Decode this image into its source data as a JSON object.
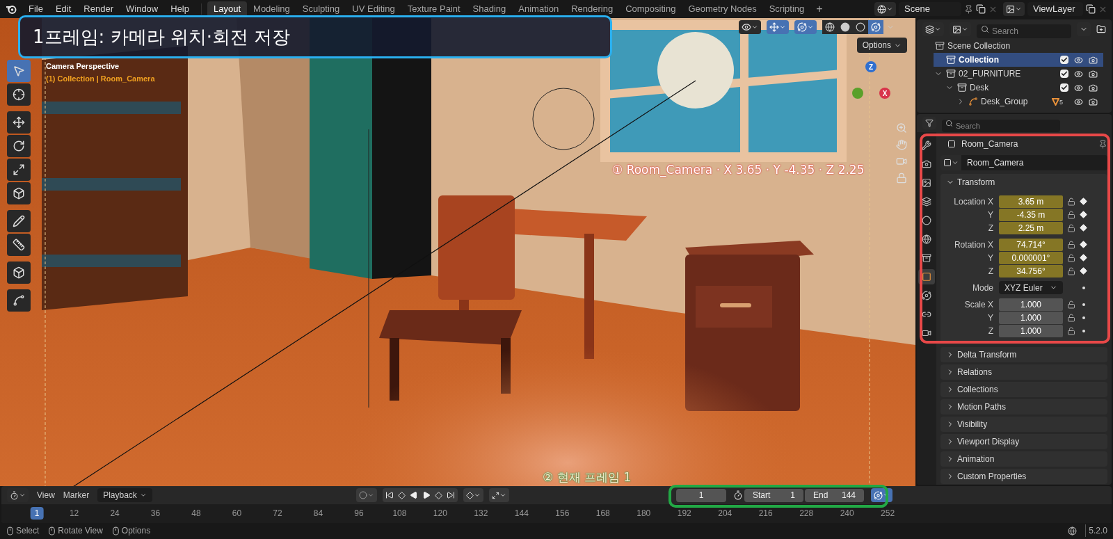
{
  "menus": [
    "File",
    "Edit",
    "Render",
    "Window",
    "Help"
  ],
  "workspaces": [
    {
      "label": "Layout",
      "selected": true
    },
    {
      "label": "Modeling",
      "selected": false
    },
    {
      "label": "Sculpting",
      "selected": false
    },
    {
      "label": "UV Editing",
      "selected": false
    },
    {
      "label": "Texture Paint",
      "selected": false
    },
    {
      "label": "Shading",
      "selected": false
    },
    {
      "label": "Animation",
      "selected": false
    },
    {
      "label": "Rendering",
      "selected": false
    },
    {
      "label": "Compositing",
      "selected": false
    },
    {
      "label": "Geometry Nodes",
      "selected": false
    },
    {
      "label": "Scripting",
      "selected": false
    }
  ],
  "add_workspace": "+",
  "scene": "Scene",
  "view_layer": "ViewLayer",
  "viewport": {
    "view_name": "Camera Perspective",
    "context": "(1) Collection | Room_Camera",
    "options": "Options",
    "shading_modes": [
      {
        "kind": "wireframe",
        "selected": false
      },
      {
        "kind": "solid",
        "selected": false
      },
      {
        "kind": "material",
        "selected": false
      },
      {
        "kind": "rendered",
        "selected": true
      }
    ],
    "gizmo_axes": [
      {
        "label": "Z",
        "color": "#2f6fd0"
      },
      {
        "label": "X",
        "color": "#d8344a"
      }
    ]
  },
  "callouts": {
    "title": "1프레임: 카메라 위치·회전 저장",
    "camera_label": "① Room_Camera · X 3.65 · Y -4.35 · Z 2.25",
    "frame_label": "② 현재 프레임 1"
  },
  "outliner": {
    "search_placeholder": "Search",
    "tree": [
      {
        "name": "Scene Collection",
        "kind": "scene",
        "selected": false,
        "children": [
          {
            "name": "Collection",
            "kind": "collection",
            "selected": true,
            "checked": true
          },
          {
            "name": "02_FURNITURE",
            "kind": "collection",
            "selected": false,
            "checked": true,
            "expanded": true,
            "children": [
              {
                "name": "Desk",
                "kind": "collection",
                "selected": false,
                "checked": true,
                "expanded": true,
                "children": [
                  {
                    "name": "Desk_Group",
                    "kind": "object",
                    "selected": false,
                    "expanded": false,
                    "badge": "5"
                  }
                ]
              }
            ]
          }
        ]
      }
    ]
  },
  "properties": {
    "search_placeholder": "Search",
    "object_name": "Room_Camera",
    "datablock": "Room_Camera",
    "tabs": [
      {
        "kind": "tool",
        "selected": false
      },
      {
        "kind": "render",
        "selected": false
      },
      {
        "kind": "output",
        "selected": false
      },
      {
        "kind": "view-layer",
        "selected": false
      },
      {
        "kind": "scene",
        "selected": false
      },
      {
        "kind": "world",
        "selected": false
      },
      {
        "kind": "collection",
        "selected": false
      },
      {
        "kind": "object",
        "selected": true
      },
      {
        "kind": "physics",
        "selected": false
      },
      {
        "kind": "constraints",
        "selected": false
      },
      {
        "kind": "data",
        "selected": false
      }
    ],
    "transform": {
      "title": "Transform",
      "expanded": true,
      "rows": [
        {
          "kind": "number",
          "label": "Location X",
          "value": "3.65 m",
          "keyed": true
        },
        {
          "kind": "number",
          "label": "Y",
          "value": "-4.35 m",
          "keyed": true
        },
        {
          "kind": "number",
          "label": "Z",
          "value": "2.25 m",
          "keyed": true
        },
        {
          "kind": "number",
          "label": "Rotation X",
          "value": "74.714°",
          "keyed": true
        },
        {
          "kind": "number",
          "label": "Y",
          "value": "0.000001°",
          "keyed": true
        },
        {
          "kind": "number",
          "label": "Z",
          "value": "34.756°",
          "keyed": true
        },
        {
          "kind": "select",
          "label": "Mode",
          "value": "XYZ Euler",
          "keyed": false
        },
        {
          "kind": "number",
          "label": "Scale X",
          "value": "1.000",
          "keyed": false
        },
        {
          "kind": "number",
          "label": "Y",
          "value": "1.000",
          "keyed": false
        },
        {
          "kind": "number",
          "label": "Z",
          "value": "1.000",
          "keyed": false
        }
      ]
    },
    "panels": [
      {
        "title": "Delta Transform",
        "expanded": false
      },
      {
        "title": "Relations",
        "expanded": false
      },
      {
        "title": "Collections",
        "expanded": false
      },
      {
        "title": "Motion Paths",
        "expanded": false
      },
      {
        "title": "Visibility",
        "expanded": false
      },
      {
        "title": "Viewport Display",
        "expanded": false
      },
      {
        "title": "Animation",
        "expanded": false
      },
      {
        "title": "Custom Properties",
        "expanded": false
      }
    ]
  },
  "timeline": {
    "menus": [
      "View",
      "Marker"
    ],
    "playback": "Playback",
    "current_frame": "1",
    "start_label": "Start",
    "start": "1",
    "end_label": "End",
    "end": "144",
    "ticks": [
      {
        "label": "1",
        "selected": true
      },
      {
        "label": "12",
        "selected": false
      },
      {
        "label": "24",
        "selected": false
      },
      {
        "label": "36",
        "selected": false
      },
      {
        "label": "48",
        "selected": false
      },
      {
        "label": "60",
        "selected": false
      },
      {
        "label": "72",
        "selected": false
      },
      {
        "label": "84",
        "selected": false
      },
      {
        "label": "96",
        "selected": false
      },
      {
        "label": "108",
        "selected": false
      },
      {
        "label": "120",
        "selected": false
      },
      {
        "label": "132",
        "selected": false
      },
      {
        "label": "144",
        "selected": false
      },
      {
        "label": "156",
        "selected": false
      },
      {
        "label": "168",
        "selected": false
      },
      {
        "label": "180",
        "selected": false
      },
      {
        "label": "192",
        "selected": false
      },
      {
        "label": "204",
        "selected": false
      },
      {
        "label": "216",
        "selected": false
      },
      {
        "label": "228",
        "selected": false
      },
      {
        "label": "240",
        "selected": false
      },
      {
        "label": "252",
        "selected": false
      }
    ]
  },
  "status_bar": {
    "hints": [
      "Select",
      "Rotate View",
      "Options"
    ],
    "version": "5.2.0"
  }
}
